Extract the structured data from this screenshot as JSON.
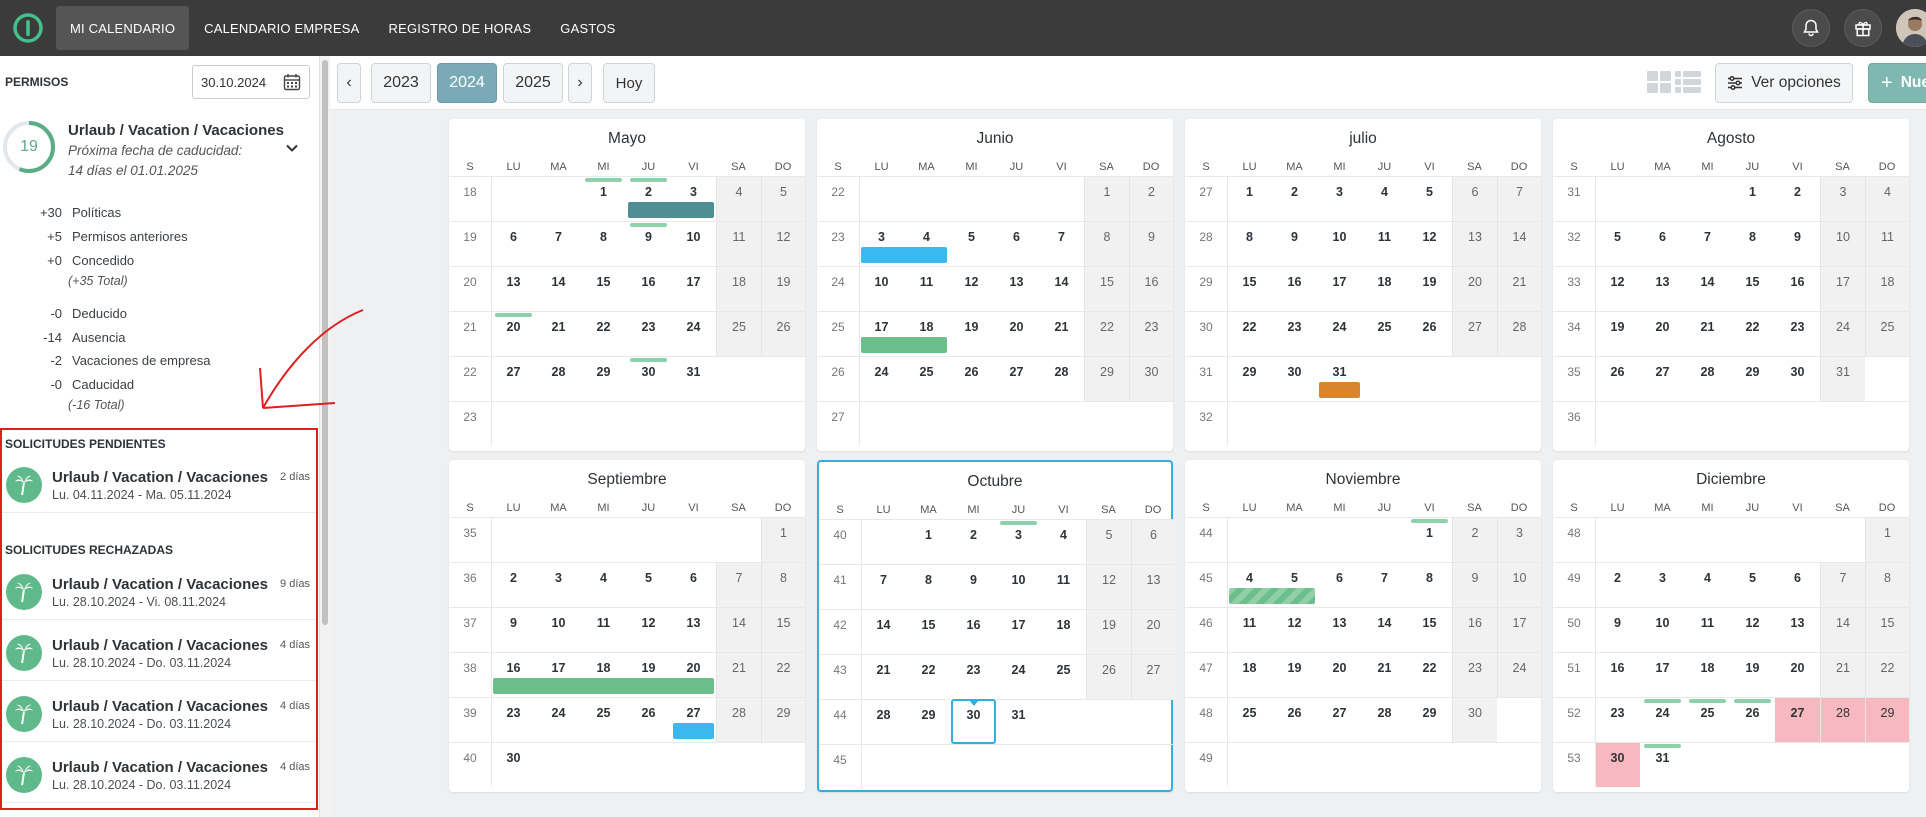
{
  "nav": {
    "items": [
      "MI CALENDARIO",
      "CALENDARIO EMPRESA",
      "REGISTRO DE HORAS",
      "GASTOS"
    ],
    "active_index": 0,
    "logo_color": "#43c08a"
  },
  "sidebar": {
    "section_title": "PERMISOS",
    "date_value": "30.10.2024",
    "leave_type": {
      "remaining": "19",
      "name": "Urlaub / Vacation / Vacaciones",
      "expiry_label": "Próxima fecha de caducidad:",
      "expiry_value": "14 días el 01.01.2025"
    },
    "credits": [
      {
        "amount": "+30",
        "label": "Políticas"
      },
      {
        "amount": "+5",
        "label": "Permisos anteriores"
      },
      {
        "amount": "+0",
        "label": "Concedido"
      }
    ],
    "credits_total": "(+35 Total)",
    "debits": [
      {
        "amount": "-0",
        "label": "Deducido"
      },
      {
        "amount": "-14",
        "label": "Ausencia"
      },
      {
        "amount": "-2",
        "label": "Vacaciones de empresa"
      },
      {
        "amount": "-0",
        "label": "Caducidad"
      }
    ],
    "debits_total": "(-16 Total)",
    "pending_title": "SOLICITUDES PENDIENTES",
    "pending": [
      {
        "name": "Urlaub / Vacation / Vacaciones",
        "dates": "Lu. 04.11.2024 - Ma. 05.11.2024",
        "days": "2 días"
      }
    ],
    "rejected_title": "SOLICITUDES RECHAZADAS",
    "rejected": [
      {
        "name": "Urlaub / Vacation / Vacaciones",
        "dates": "Lu. 28.10.2024 - Vi. 08.11.2024",
        "days": "9 días"
      },
      {
        "name": "Urlaub / Vacation / Vacaciones",
        "dates": "Lu. 28.10.2024 - Do. 03.11.2024",
        "days": "4 días"
      },
      {
        "name": "Urlaub / Vacation / Vacaciones",
        "dates": "Lu. 28.10.2024 - Do. 03.11.2024",
        "days": "4 días"
      },
      {
        "name": "Urlaub / Vacation / Vacaciones",
        "dates": "Lu. 28.10.2024 - Do. 03.11.2024",
        "days": "4 días"
      }
    ]
  },
  "toolbar": {
    "prev": "‹",
    "years": [
      "2023",
      "2024",
      "2025"
    ],
    "selected_year": "2024",
    "next": "›",
    "today_label": "Hoy",
    "options_label": "Ver opciones",
    "new_label": "Nue",
    "accent": "#7aaab5"
  },
  "calendar": {
    "weekday_headers": [
      "S",
      "LU",
      "MA",
      "MI",
      "JU",
      "VI",
      "SA",
      "DO"
    ],
    "colors": {
      "teal": "#4f8f93",
      "blue": "#39b9f0",
      "green": "#6cbf8b",
      "orange": "#d9852e",
      "holiday": "#f7b9bf",
      "tick": "#8cd1a9",
      "today": "#33aee0"
    },
    "months": [
      {
        "name": "Mayo",
        "first_dow": 2,
        "days": 31,
        "week_start": 18,
        "events": [
          {
            "start": 2,
            "end": 3,
            "color": "teal"
          }
        ],
        "ticks": [
          1,
          9,
          20,
          30,
          2
        ]
      },
      {
        "name": "Junio",
        "first_dow": 5,
        "days": 30,
        "week_start": 22,
        "events": [
          {
            "start": 3,
            "end": 4,
            "color": "blue"
          },
          {
            "start": 17,
            "end": 18,
            "color": "green"
          }
        ],
        "ticks": []
      },
      {
        "name": "julio",
        "first_dow": 0,
        "days": 31,
        "week_start": 27,
        "events": [
          {
            "start": 31,
            "end": 31,
            "color": "orange"
          }
        ],
        "ticks": []
      },
      {
        "name": "Agosto",
        "first_dow": 3,
        "days": 31,
        "week_start": 31,
        "events": [],
        "ticks": []
      },
      {
        "name": "Septiembre",
        "first_dow": 6,
        "days": 30,
        "week_start": 35,
        "events": [
          {
            "start": 16,
            "end": 20,
            "color": "green"
          },
          {
            "start": 27,
            "end": 27,
            "color": "blue"
          }
        ],
        "ticks": []
      },
      {
        "name": "Octubre",
        "first_dow": 1,
        "days": 31,
        "week_start": 40,
        "events": [],
        "ticks": [
          3
        ],
        "today": 30,
        "current": true
      },
      {
        "name": "Noviembre",
        "first_dow": 4,
        "days": 30,
        "week_start": 44,
        "events": [
          {
            "start": 4,
            "end": 5,
            "color": "green",
            "striped": true
          }
        ],
        "ticks": [
          1
        ]
      },
      {
        "name": "Diciembre",
        "first_dow": 6,
        "days": 31,
        "week_start": 48,
        "events": [],
        "ticks": [
          24,
          25,
          26,
          31
        ],
        "holidays": [
          27,
          28,
          29,
          30
        ]
      }
    ]
  }
}
